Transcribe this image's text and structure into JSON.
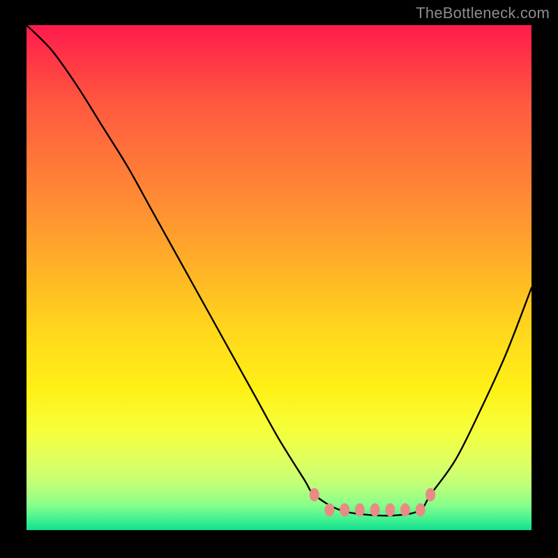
{
  "watermark": "TheBottleneck.com",
  "chart_data": {
    "type": "line",
    "title": "",
    "xlabel": "",
    "ylabel": "",
    "xlim": [
      0,
      100
    ],
    "ylim": [
      0,
      100
    ],
    "grid": false,
    "legend": false,
    "background_gradient": {
      "stops": [
        {
          "pos": 0.0,
          "color": "#ff1a4d"
        },
        {
          "pos": 0.4,
          "color": "#ff9a2f"
        },
        {
          "pos": 0.72,
          "color": "#fff016"
        },
        {
          "pos": 0.95,
          "color": "#88ff8a"
        },
        {
          "pos": 1.0,
          "color": "#10e090"
        }
      ]
    },
    "series": [
      {
        "name": "bottleneck-curve",
        "x": [
          0,
          5,
          10,
          15,
          20,
          25,
          30,
          35,
          40,
          45,
          50,
          55,
          57,
          62,
          68,
          74,
          78,
          80,
          85,
          90,
          95,
          100
        ],
        "y": [
          100,
          95,
          88,
          80,
          72,
          63,
          54,
          45,
          36,
          27,
          18,
          10,
          7,
          4,
          3,
          3,
          4,
          7,
          14,
          24,
          35,
          48
        ]
      }
    ],
    "markers": {
      "name": "optimal-zone-markers",
      "color": "#e88b86",
      "points": [
        {
          "x": 57,
          "y": 7
        },
        {
          "x": 60,
          "y": 4
        },
        {
          "x": 63,
          "y": 4
        },
        {
          "x": 66,
          "y": 4
        },
        {
          "x": 69,
          "y": 4
        },
        {
          "x": 72,
          "y": 4
        },
        {
          "x": 75,
          "y": 4
        },
        {
          "x": 78,
          "y": 4
        },
        {
          "x": 80,
          "y": 7
        }
      ]
    }
  }
}
